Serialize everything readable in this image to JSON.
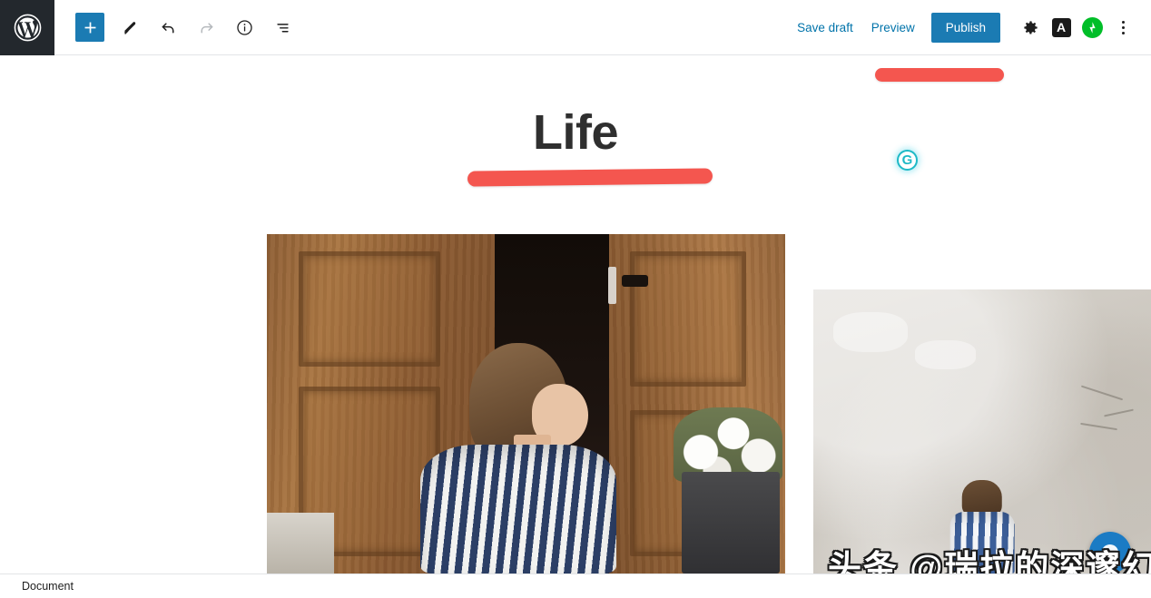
{
  "app": {
    "name": "WordPress Block Editor"
  },
  "toolbar": {
    "wp_logo_icon": "wordpress-logo-icon",
    "left_buttons": [
      {
        "name": "add-block-button",
        "icon": "plus-icon",
        "label": "+",
        "state": "active"
      },
      {
        "name": "edit-tool-button",
        "icon": "pencil-icon",
        "label": "",
        "state": "enabled"
      },
      {
        "name": "undo-button",
        "icon": "undo-arrow-icon",
        "label": "",
        "state": "enabled"
      },
      {
        "name": "redo-button",
        "icon": "redo-arrow-icon",
        "label": "",
        "state": "disabled"
      },
      {
        "name": "details-button",
        "icon": "info-circle-icon",
        "label": "",
        "state": "enabled"
      },
      {
        "name": "list-view-button",
        "icon": "list-view-icon",
        "label": "",
        "state": "enabled"
      }
    ],
    "save_draft_label": "Save draft",
    "preview_label": "Preview",
    "publish_label": "Publish",
    "settings_icon": "gear-icon",
    "amp_label": "A",
    "amp_icon": "amp-badge-icon",
    "jetpack_icon": "jetpack-bolt-icon",
    "more_menu_icon": "kebab-menu-icon",
    "accent_color": "#1b7bb3",
    "link_color": "#0073aa",
    "logo_bg_color": "#23282d"
  },
  "editor": {
    "post_title": "Life",
    "annotations": [
      {
        "name": "title-underline-marker",
        "color": "#f4564f"
      },
      {
        "name": "top-right-marker",
        "color": "#f4564f"
      }
    ],
    "grammarly_badge": {
      "label": "G",
      "color": "#1eb9c6"
    },
    "blocks": [
      {
        "name": "image-block-woman-doorway",
        "type": "image",
        "alt": "Woman in striped shirt sitting in a wooden doorway"
      },
      {
        "name": "image-block-person-wall",
        "type": "image",
        "alt": "Person in blue striped shirt seated before a concrete wall"
      }
    ],
    "watermark_text": "头条 @瑞拉的深邃幻想",
    "chat_widget_icon": "chat-bubble-icon"
  },
  "statusbar": {
    "breadcrumb": "Document"
  }
}
